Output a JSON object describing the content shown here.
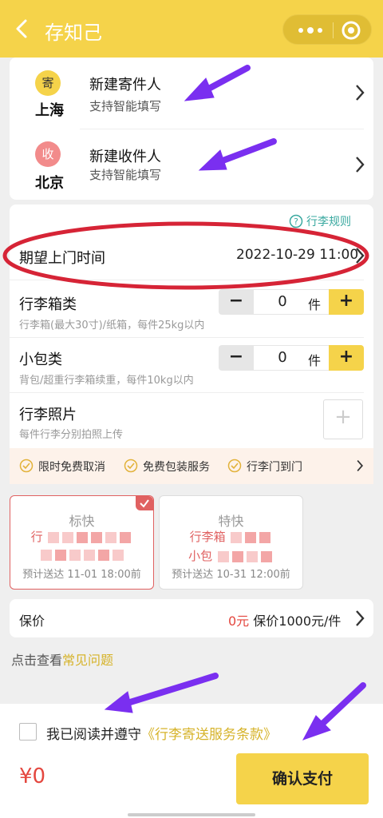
{
  "nav": {
    "title": "存知己"
  },
  "sender": {
    "badge": "寄",
    "city": "上海",
    "title": "新建寄件人",
    "subtitle": "支持智能填写"
  },
  "receiver": {
    "badge": "收",
    "city": "北京",
    "title": "新建收件人",
    "subtitle": "支持智能填写"
  },
  "rules_link": "行李规则",
  "pickup": {
    "label": "期望上门时间",
    "value": "2022-10-29 11:00"
  },
  "suitcase": {
    "label": "行李箱类",
    "desc": "行李箱(最大30寸)/纸箱，每件25kg以内",
    "count": "0",
    "unit": "件"
  },
  "smallbag": {
    "label": "小包类",
    "desc": "背包/超重行李箱续重，每件10kg以内",
    "count": "0",
    "unit": "件"
  },
  "photo": {
    "label": "行李照片",
    "desc": "每件行李分别拍照上传"
  },
  "features": [
    "限时免费取消",
    "免费包装服务",
    "行李门到门"
  ],
  "services": [
    {
      "name": "标快",
      "line1": "行",
      "line2": "",
      "eta": "预计送达 11-01 18:00前",
      "selected": true
    },
    {
      "name": "特快",
      "line1": "行李箱",
      "line2": "小包",
      "eta": "预计送达 10-31 12:00前",
      "selected": false
    }
  ],
  "insurance": {
    "label": "保价",
    "amount": "0元",
    "detail": "保价1000元/件"
  },
  "faq": {
    "prefix": "点击查看",
    "link": "常见问题"
  },
  "agreement": {
    "text": "我已阅读并遵守",
    "link": "《行李寄送服务条款》"
  },
  "total": "¥0",
  "pay_button": "确认支付",
  "colors": {
    "brand": "#f5d34a",
    "accent_link": "#d6b32a",
    "price": "#e4473f",
    "annotation_red": "#d62436",
    "annotation_purple": "#7a2ff0"
  }
}
